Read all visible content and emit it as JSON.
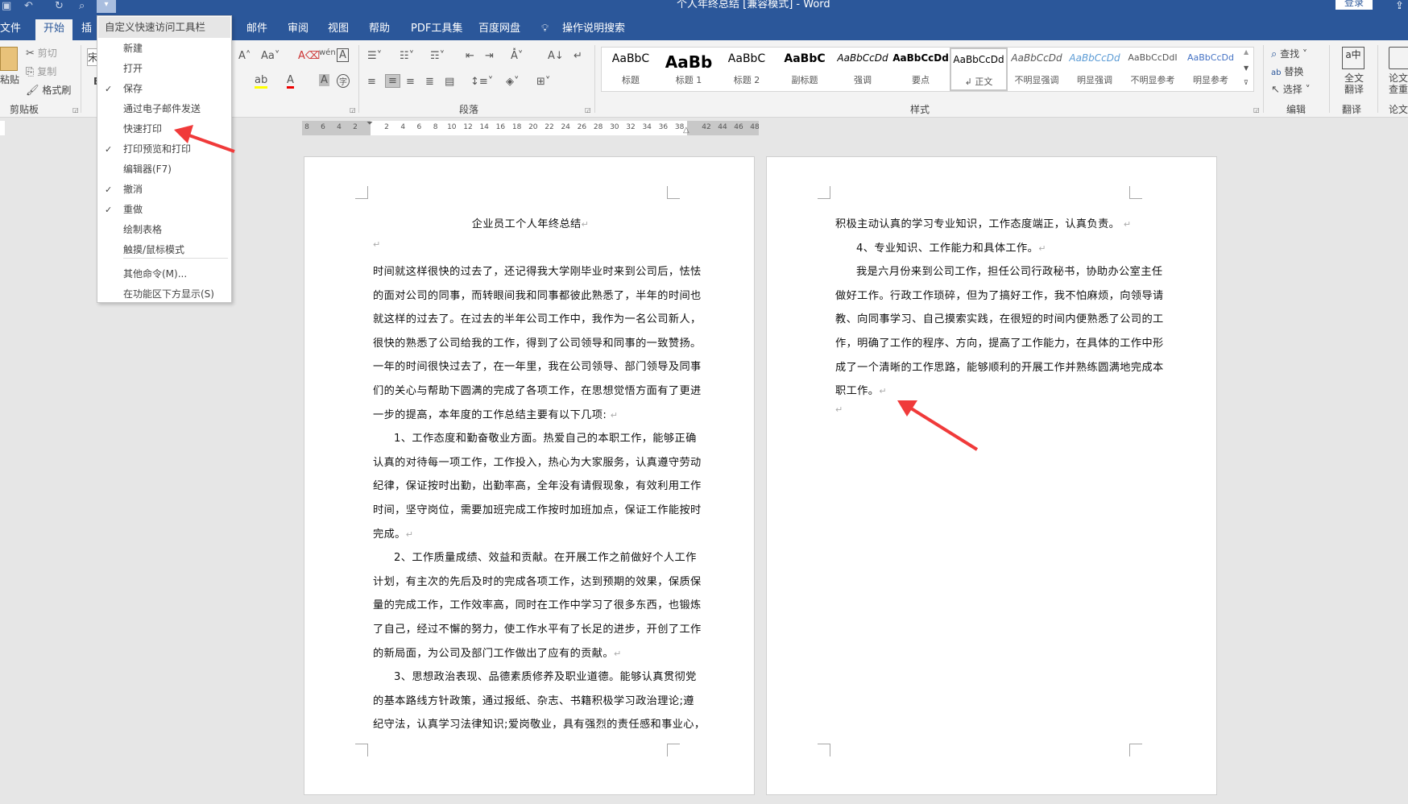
{
  "window": {
    "title": "个人年终总结 [兼容模式]  -  Word",
    "login": "登录",
    "qa_custom_glyph": "▾"
  },
  "tabs": [
    "文件",
    "开始",
    "插",
    "邮件",
    "审阅",
    "视图",
    "帮助",
    "PDF工具集",
    "百度网盘",
    "操作说明搜索"
  ],
  "ribbon": {
    "clipboard": {
      "paste": "粘贴",
      "cut": "剪切",
      "copy": "复制",
      "format_painter": "格式刷",
      "label": "剪贴板"
    },
    "font": {
      "font_box": "宋",
      "bold": "B"
    },
    "paragraph": {
      "label": "段落"
    },
    "styles": {
      "label": "样式",
      "items": [
        {
          "sample": "AaBbC",
          "name": "标题"
        },
        {
          "sample": "AaBb",
          "name": "标题 1"
        },
        {
          "sample": "AaBbC",
          "name": "标题 2"
        },
        {
          "sample": "AaBbC",
          "name": "副标题"
        },
        {
          "sample": "AaBbCcDd",
          "name": "强调"
        },
        {
          "sample": "AaBbCcDd",
          "name": "要点"
        },
        {
          "sample": "AaBbCcDd",
          "name": "↲ 正文"
        },
        {
          "sample": "AaBbCcDd",
          "name": "不明显强调"
        },
        {
          "sample": "AaBbCcDd",
          "name": "明显强调"
        },
        {
          "sample": "AaBbCcDdI",
          "name": "不明显参考"
        },
        {
          "sample": "AaBbCcDd",
          "name": "明显参考"
        }
      ],
      "selected": 6
    },
    "editing": {
      "find": "查找",
      "replace": "替换",
      "select": "选择",
      "label": "编辑"
    },
    "translate": {
      "button": "全文翻译",
      "label": "翻译"
    },
    "paper": {
      "button": "论文查重",
      "label": "论文"
    }
  },
  "ruler": {
    "left": [
      "8",
      "6",
      "4",
      "2"
    ],
    "main": [
      "2",
      "4",
      "6",
      "8",
      "10",
      "12",
      "14",
      "16",
      "18",
      "20",
      "22",
      "24",
      "26",
      "28",
      "30",
      "32",
      "34",
      "36",
      "38"
    ],
    "right": [
      "42",
      "44",
      "46",
      "48"
    ]
  },
  "menu": {
    "title": "自定义快速访问工具栏",
    "items": [
      {
        "label": "新建",
        "checked": false
      },
      {
        "label": "打开",
        "checked": false
      },
      {
        "label": "保存",
        "checked": true
      },
      {
        "label": "通过电子邮件发送",
        "checked": false
      },
      {
        "label": "快速打印",
        "checked": false
      },
      {
        "label": "打印预览和打印",
        "checked": true
      },
      {
        "label": "编辑器(F7)",
        "checked": false
      },
      {
        "label": "撤消",
        "checked": true
      },
      {
        "label": "重做",
        "checked": true
      },
      {
        "label": "绘制表格",
        "checked": false
      },
      {
        "label": "触摸/鼠标模式",
        "checked": false
      },
      {
        "label": "其他命令(M)...",
        "checked": false
      },
      {
        "label": "在功能区下方显示(S)",
        "checked": false
      }
    ],
    "check_glyph": "✓"
  },
  "annotation_color": "#f03a3a",
  "page1": {
    "title": "企业员工个人年终总结",
    "lines": [
      {
        "t": "时间就这样很快的过去了，还记得我大学刚毕业时来到公司后，怯怯",
        "full": true
      },
      {
        "t": "的面对公司的同事，而转眼间我和同事都彼此熟悉了，半年的时间也",
        "full": true
      },
      {
        "t": "就这样的过去了。在过去的半年公司工作中，我作为一名公司新人，",
        "full": true
      },
      {
        "t": "很快的熟悉了公司给我的工作，得到了公司领导和同事的一致赞扬。",
        "full": true
      },
      {
        "t": "一年的时间很快过去了，在一年里，我在公司领导、部门领导及同事",
        "full": true
      },
      {
        "t": "们的关心与帮助下圆满的完成了各项工作，在思想觉悟方面有了更进",
        "full": true
      },
      {
        "t": "一步的提高，本年度的工作总结主要有以下几项: ",
        "end": true
      },
      {
        "t": "1、工作态度和勤奋敬业方面。热爱自己的本职工作，能够正确",
        "full": true,
        "indent": true
      },
      {
        "t": "认真的对待每一项工作，工作投入，热心为大家服务，认真遵守劳动",
        "full": true
      },
      {
        "t": "纪律，保证按时出勤，出勤率高，全年没有请假现象，有效利用工作",
        "full": true
      },
      {
        "t": "时间，坚守岗位，需要加班完成工作按时加班加点，保证工作能按时",
        "full": true
      },
      {
        "t": "完成。",
        "end": true
      },
      {
        "t": "2、工作质量成绩、效益和贡献。在开展工作之前做好个人工作",
        "full": true,
        "indent": true
      },
      {
        "t": "计划，有主次的先后及时的完成各项工作，达到预期的效果，保质保",
        "full": true
      },
      {
        "t": "量的完成工作，工作效率高，同时在工作中学习了很多东西，也锻炼",
        "full": true
      },
      {
        "t": "了自己，经过不懈的努力，使工作水平有了长足的进步，开创了工作",
        "full": true
      },
      {
        "t": "的新局面，为公司及部门工作做出了应有的贡献。",
        "end": true
      },
      {
        "t": "3、思想政治表现、品德素质修养及职业道德。能够认真贯彻党",
        "full": true,
        "indent": true
      },
      {
        "t": "的基本路线方针政策，通过报纸、杂志、书籍积极学习政治理论;遵",
        "full": true
      },
      {
        "t": "纪守法，认真学习法律知识;爱岗敬业，具有强烈的责任感和事业心，",
        "full": true
      }
    ]
  },
  "page2": {
    "lines": [
      {
        "t": "积极主动认真的学习专业知识，工作态度端正，认真负责。 ",
        "end": true
      },
      {
        "t": "4、专业知识、工作能力和具体工作。",
        "end": true,
        "indent": true
      },
      {
        "t": "我是六月份来到公司工作，担任公司行政秘书，协助办公室主任",
        "full": true,
        "indent": true
      },
      {
        "t": "做好工作。行政工作琐碎，但为了搞好工作，我不怕麻烦，向领导请",
        "full": true
      },
      {
        "t": "教、向同事学习、自己摸索实践，在很短的时间内便熟悉了公司的工",
        "full": true
      },
      {
        "t": "作，明确了工作的程序、方向，提高了工作能力，在具体的工作中形",
        "full": true
      },
      {
        "t": "成了一个清晰的工作思路，能够顺利的开展工作并熟练圆满地完成本",
        "full": true
      },
      {
        "t": "职工作。",
        "end": true
      }
    ]
  },
  "para_mark": "↵"
}
